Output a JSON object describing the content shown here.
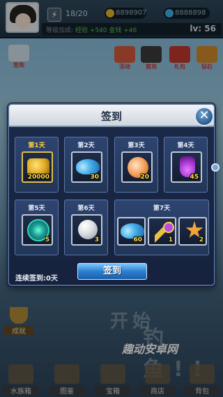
{
  "topbar": {
    "stamina": "18/20",
    "gold": "8898907",
    "gems": "8888898",
    "bonus_label": "等级加成:",
    "bonus_detail": "经验 +540  金钱 +46",
    "level": "lv: 56"
  },
  "side_icons": [
    {
      "label": "签到"
    },
    {
      "label": "活动"
    },
    {
      "label": "首充"
    },
    {
      "label": "礼包"
    },
    {
      "label": "钻石"
    }
  ],
  "background": {
    "title_1": "开始",
    "title_2": "钓鱼!!",
    "watermark": "趣动安卓网",
    "achievement_label": "成就"
  },
  "bottom_nav": [
    {
      "label": "水族箱"
    },
    {
      "label": "图鉴"
    },
    {
      "label": "宝箱"
    },
    {
      "label": "商店"
    },
    {
      "label": "背包"
    }
  ],
  "dialog": {
    "title": "签到",
    "close_icon": "close-icon",
    "days": [
      {
        "label": "第1天",
        "item": "gold-coins-icon",
        "count": "20000",
        "active": true
      },
      {
        "label": "第2天",
        "item": "blue-coral-icon",
        "count": "30"
      },
      {
        "label": "第3天",
        "item": "shell-icon",
        "count": "20"
      },
      {
        "label": "第4天",
        "item": "potion-icon",
        "count": "45"
      },
      {
        "label": "第5天",
        "item": "orb-icon",
        "count": "5"
      },
      {
        "label": "第6天",
        "item": "pearl-icon",
        "count": "3"
      }
    ],
    "day7": {
      "label": "第7天",
      "items": [
        {
          "item": "blue-coral-icon",
          "count": "60"
        },
        {
          "item": "key-icon",
          "count": "1"
        },
        {
          "item": "starfish-icon",
          "count": "2"
        }
      ]
    },
    "streak": "连续签到:0天",
    "checkin_button": "签到"
  },
  "colors": {
    "accent": "#2b7fd0",
    "dialog_bg": "#1b2a49",
    "active_day": "#ffd23a",
    "count_text": "#ffe14a"
  }
}
